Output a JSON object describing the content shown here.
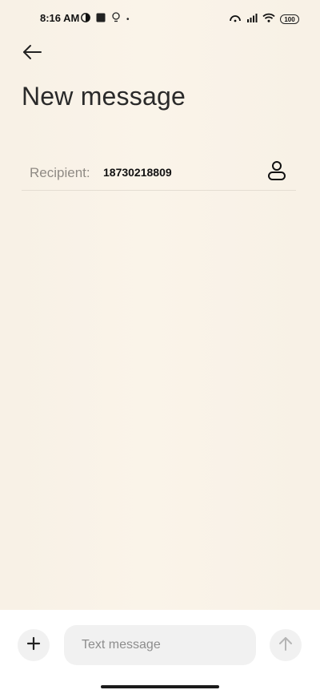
{
  "status_bar": {
    "time": "8:16 AM",
    "battery": "100",
    "dot": "•"
  },
  "header": {
    "title": "New message"
  },
  "recipient": {
    "label": "Recipient:",
    "value": "18730218809"
  },
  "compose": {
    "placeholder": "Text message",
    "value": ""
  },
  "icons": {
    "back": "back-arrow-icon",
    "contact": "person-icon",
    "add": "plus-icon",
    "send": "arrow-up-icon"
  },
  "colors": {
    "background": "#f8f1e6",
    "compose_bar": "#ffffff",
    "field": "#f1f1f1"
  }
}
